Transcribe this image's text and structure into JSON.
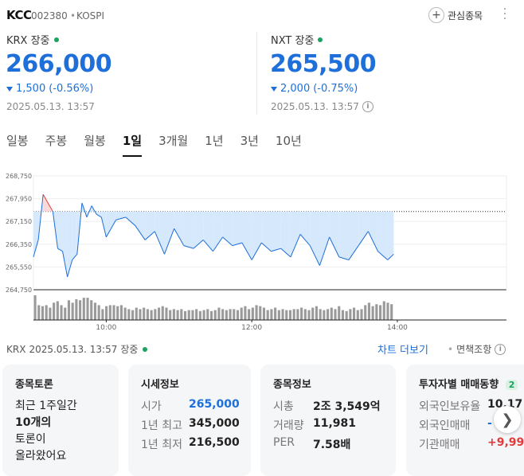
{
  "header": {
    "stock_name": "KCC",
    "stock_code": "002380",
    "separator": "•",
    "market": "KOSPI",
    "watchlist_label": "관심종목"
  },
  "krx": {
    "label": "KRX 장중",
    "price": "266,000",
    "change": "1,500",
    "change_pct": "(-0.56%)",
    "timestamp": "2025.05.13. 13:57"
  },
  "nxt": {
    "label": "NXT 장중",
    "price": "265,500",
    "change": "2,000",
    "change_pct": "(-0.75%)",
    "timestamp": "2025.05.13. 13:57"
  },
  "tabs": [
    {
      "label": "일봉"
    },
    {
      "label": "주봉"
    },
    {
      "label": "월봉"
    },
    {
      "label": "1일"
    },
    {
      "label": "3개월"
    },
    {
      "label": "1년"
    },
    {
      "label": "3년"
    },
    {
      "label": "10년"
    }
  ],
  "active_tab": "1일",
  "colors": {
    "down": "#1e6fd9",
    "up": "#e23b3b",
    "status_dot": "#1aa260"
  },
  "chart_data": {
    "type": "line",
    "y_ticks": [
      "268,750",
      "267,950",
      "267,150",
      "266,350",
      "265,550",
      "264,750"
    ],
    "ylim": [
      264750,
      268750
    ],
    "reference_price": 267500,
    "x_ticks": [
      "10:00",
      "12:00",
      "14:00"
    ],
    "time_range": [
      "09:00",
      "15:30"
    ],
    "last_time": "13:57",
    "series": [
      {
        "x": [
          "09:00",
          "09:04",
          "09:08",
          "09:12",
          "09:16",
          "09:20",
          "09:24",
          "09:28",
          "09:32",
          "09:36",
          "09:40",
          "09:44",
          "09:48",
          "09:52",
          "09:56",
          "10:00",
          "10:08",
          "10:16",
          "10:24",
          "10:32",
          "10:40",
          "10:48",
          "10:56",
          "11:04",
          "11:12",
          "11:20",
          "11:28",
          "11:36",
          "11:44",
          "11:52",
          "12:00",
          "12:08",
          "12:16",
          "12:24",
          "12:32",
          "12:40",
          "12:48",
          "12:56",
          "13:04",
          "13:12",
          "13:20",
          "13:28",
          "13:36",
          "13:44",
          "13:52",
          "13:57"
        ],
        "values": [
          265900,
          266500,
          268100,
          267800,
          267500,
          266200,
          266100,
          265200,
          265800,
          266000,
          267800,
          267300,
          267700,
          267400,
          267300,
          266600,
          267200,
          267300,
          267000,
          266500,
          266800,
          266000,
          266900,
          266300,
          266200,
          266500,
          266100,
          266600,
          266300,
          266400,
          265800,
          266400,
          266100,
          266200,
          265900,
          266700,
          266300,
          265600,
          266600,
          265900,
          265800,
          266300,
          266800,
          266100,
          265800,
          266000
        ]
      }
    ],
    "volume_tick_labels": [
      "10:00",
      "12:00",
      "14:00"
    ],
    "volume": [
      50,
      30,
      28,
      30,
      25,
      35,
      38,
      30,
      25,
      40,
      35,
      42,
      40,
      45,
      45,
      40,
      35,
      30,
      22,
      28,
      30,
      30,
      28,
      30,
      25,
      22,
      20,
      25,
      22,
      25,
      22,
      20,
      22,
      25,
      28,
      25,
      20,
      22,
      20,
      22,
      18,
      20,
      20,
      22,
      18,
      20,
      22,
      18,
      20,
      25,
      22,
      20,
      22,
      22,
      20,
      25,
      28,
      22,
      25,
      30,
      28,
      25,
      20,
      22,
      25,
      20,
      22,
      20,
      20,
      22,
      22,
      25,
      22,
      20,
      25,
      28,
      22,
      20,
      22,
      25,
      22,
      28,
      20,
      18,
      22,
      25,
      20,
      22,
      30,
      35,
      28,
      32,
      30,
      38,
      35,
      32
    ]
  },
  "footer": {
    "source": "KRX",
    "timestamp": "2025.05.13. 13:57",
    "status": "장중",
    "chart_more": "차트 더보기",
    "separator": "•",
    "area_guide": "면책조항"
  },
  "cards": {
    "discussion": {
      "title": "종목토론",
      "line1": "최근 1주일간",
      "count": "10개의",
      "line3": "토론이",
      "line4": "올라왔어요"
    },
    "quote": {
      "title": "시세정보",
      "rows": [
        {
          "key": "시가",
          "value": "265,000"
        },
        {
          "key": "1년 최고",
          "value": "345,000"
        },
        {
          "key": "1년 최저",
          "value": "216,500"
        }
      ]
    },
    "info": {
      "title": "종목정보",
      "rows": [
        {
          "key": "시총",
          "value": "2조 3,549억"
        },
        {
          "key": "거래량",
          "value": "11,981"
        },
        {
          "key": "PER",
          "value": "7.58배"
        }
      ]
    },
    "investor": {
      "title": "투자자별 매매동향",
      "badge": "2",
      "rows": [
        {
          "key": "외국인보유율",
          "value": "10.17"
        },
        {
          "key": "외국인매매",
          "value": "-"
        },
        {
          "key": "기관매매",
          "value": "+9,99"
        }
      ]
    }
  }
}
